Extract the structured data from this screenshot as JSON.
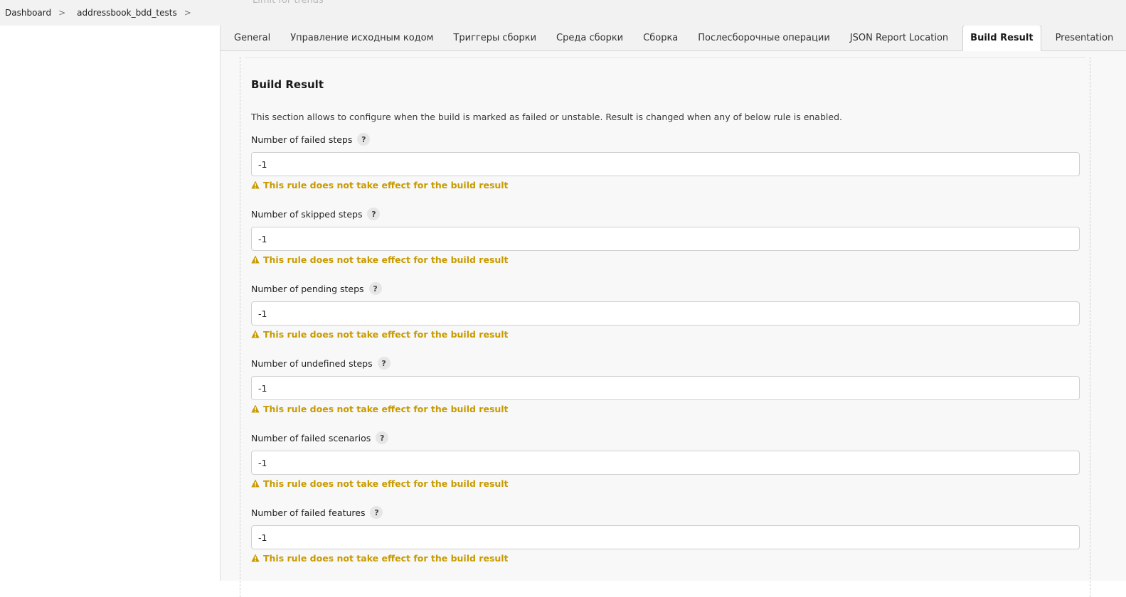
{
  "breadcrumb": {
    "items": [
      "Dashboard",
      "addressbook_bdd_tests"
    ],
    "separator": ">"
  },
  "ghost_label": "Limit for trends",
  "tabs": [
    {
      "label": "General"
    },
    {
      "label": "Управление исходным кодом"
    },
    {
      "label": "Триггеры сборки"
    },
    {
      "label": "Среда сборки"
    },
    {
      "label": "Сборка"
    },
    {
      "label": "Послесборочные операции"
    },
    {
      "label": "JSON Report Location"
    },
    {
      "label": "Build Result",
      "active": true
    },
    {
      "label": "Presentation"
    }
  ],
  "section": {
    "title": "Build Result",
    "description": "This section allows to configure when the build is marked as failed or unstable. Result is changed when any of below rule is enabled.",
    "help_symbol": "?",
    "warning_text": "This rule does not take effect for the build result",
    "fields": [
      {
        "label": "Number of failed steps",
        "value": "-1"
      },
      {
        "label": "Number of skipped steps",
        "value": "-1"
      },
      {
        "label": "Number of pending steps",
        "value": "-1"
      },
      {
        "label": "Number of undefined steps",
        "value": "-1"
      },
      {
        "label": "Number of failed scenarios",
        "value": "-1"
      },
      {
        "label": "Number of failed features",
        "value": "-1"
      }
    ]
  },
  "colors": {
    "warning": "#c89b00",
    "tab_bar": "#f2f2f2",
    "content_bg": "#f8f8f8"
  }
}
